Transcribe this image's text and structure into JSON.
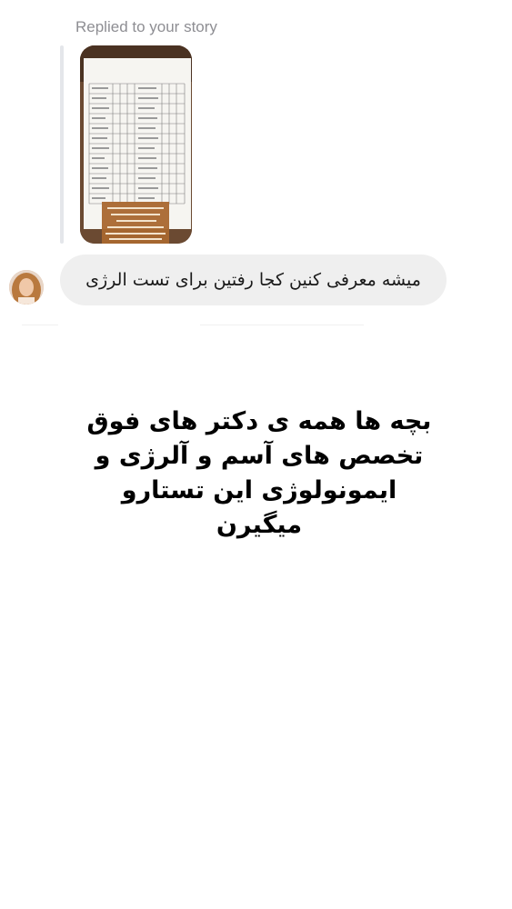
{
  "reply": {
    "label": "Replied to your story"
  },
  "message": {
    "text": "میشه معرفی کنین کجا رفتین برای تست الرژی"
  },
  "overlay": {
    "lines": [
      "بچه ها همه ی دکتر های فوق",
      "تخصص های آسم و آلرژی و",
      "ایمونولوژی این تستارو",
      "میگیرن"
    ]
  },
  "icons": {
    "avatar": "profile-photo",
    "story": "story-thumbnail"
  }
}
